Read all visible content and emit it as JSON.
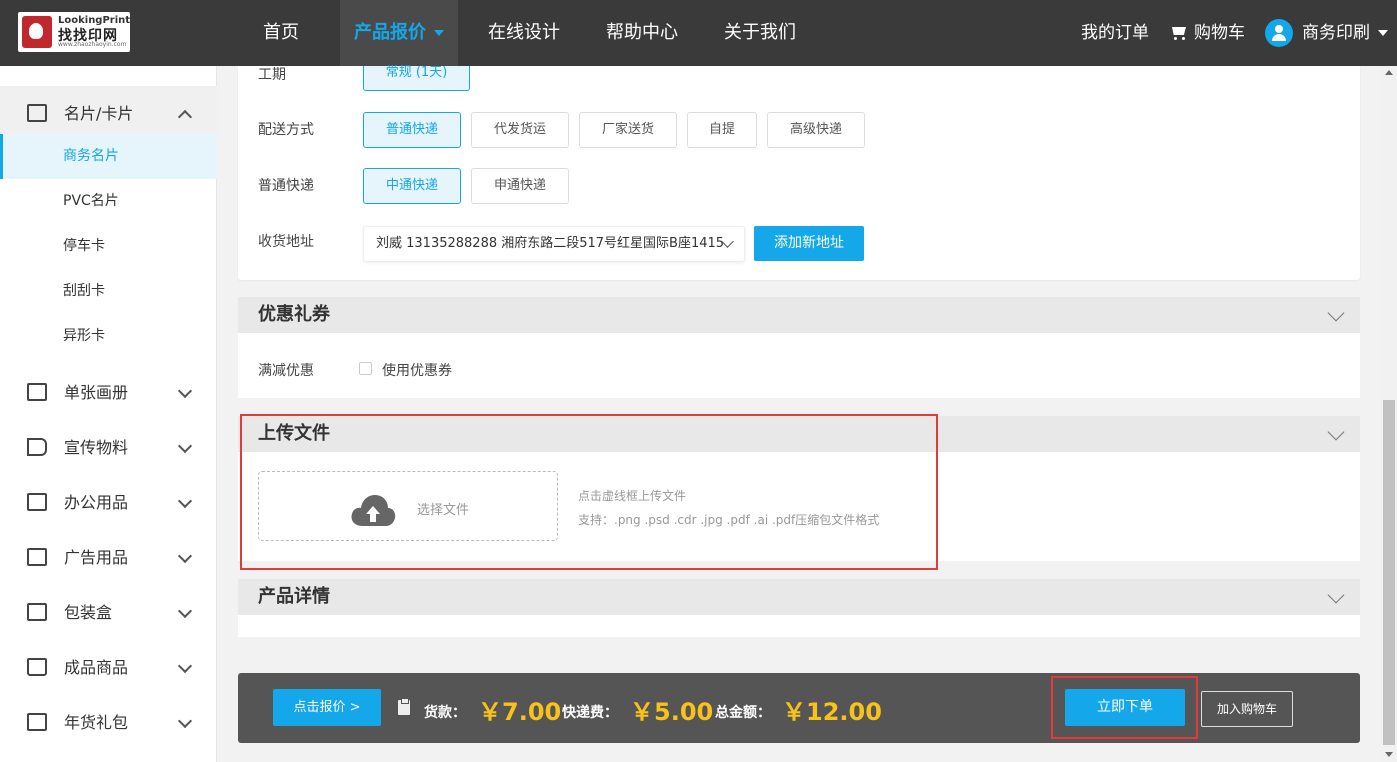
{
  "logo": {
    "line1": "LookingPrint",
    "line2": "找找印网",
    "line3": "www.zhaozhaoyin.com"
  },
  "nav": {
    "items": [
      "首页",
      "产品报价",
      "在线设计",
      "帮助中心",
      "关于我们"
    ],
    "my_orders": "我的订单",
    "cart": "购物车",
    "user": "商务印刷"
  },
  "sidebar": {
    "categories": [
      {
        "label": "名片/卡片",
        "icon": "id-card-icon"
      },
      {
        "label": "单张画册",
        "icon": "document-icon"
      },
      {
        "label": "宣传物料",
        "icon": "megaphone-icon"
      },
      {
        "label": "办公用品",
        "icon": "notebook-icon"
      },
      {
        "label": "广告用品",
        "icon": "billboard-icon"
      },
      {
        "label": "包装盒",
        "icon": "box-icon"
      },
      {
        "label": "成品商品",
        "icon": "bag-icon"
      },
      {
        "label": "年货礼包",
        "icon": "gift-icon"
      }
    ],
    "subitems": [
      "商务名片",
      "PVC名片",
      "停车卡",
      "刮刮卡",
      "异形卡"
    ]
  },
  "order": {
    "period_label": "工期",
    "period_value": "常规 (1天)",
    "delivery_label": "配送方式",
    "delivery_options": [
      "普通快递",
      "代发货运",
      "厂家送货",
      "自提",
      "高级快递"
    ],
    "express_label": "普通快递",
    "express_options": [
      "中通快递",
      "申通快递"
    ],
    "address_label": "收货地址",
    "address_value": "刘威 13135288288 湘府东路二段517号红星国际B座1415",
    "add_address": "添加新地址"
  },
  "coupon": {
    "title": "优惠礼券",
    "label": "满减优惠",
    "checkbox_label": "使用优惠券"
  },
  "upload": {
    "title": "上传文件",
    "choose": "选择文件",
    "hint1": "点击虚线框上传文件",
    "hint2": "支持：.png .psd .cdr .jpg .pdf .ai .pdf压缩包文件格式"
  },
  "details": {
    "title": "产品详情"
  },
  "bottom": {
    "quote_button": "点击报价 >",
    "goods_label": "货款：",
    "goods_value": "￥7.00",
    "shipping_label": "快递费：",
    "shipping_value": "￥5.00",
    "total_label": "总金额：",
    "total_value": "￥12.00",
    "order_button": "立即下单",
    "cart_button": "加入购物车"
  },
  "colors": {
    "accent": "#14a7e9",
    "price": "#f9c21b",
    "highlight": "#e03c3c",
    "nav_bg": "#3a3a3a"
  }
}
